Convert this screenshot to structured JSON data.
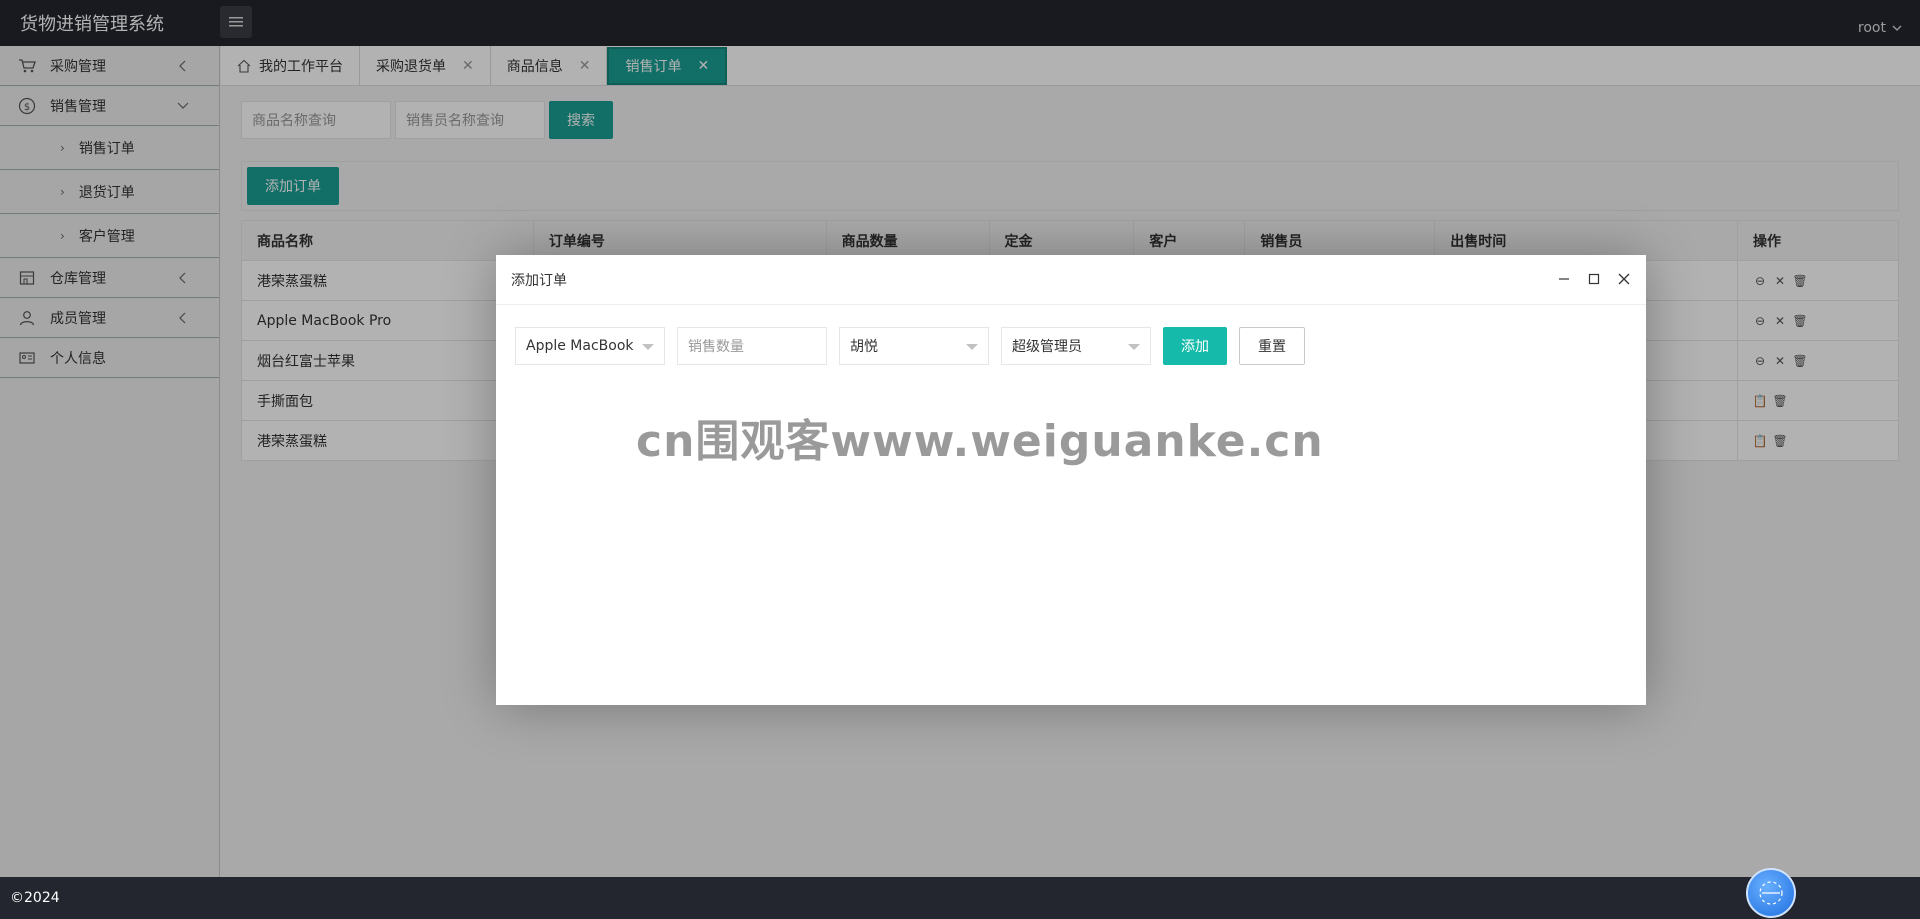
{
  "app": {
    "title": "货物进销管理系统",
    "user": "root"
  },
  "sidebar": {
    "items": [
      {
        "label": "采购管理",
        "icon": "cart-icon",
        "expanded": false
      },
      {
        "label": "销售管理",
        "icon": "dollar-circle-icon",
        "expanded": true,
        "children": [
          {
            "label": "销售订单"
          },
          {
            "label": "退货订单"
          },
          {
            "label": "客户管理"
          }
        ]
      },
      {
        "label": "仓库管理",
        "icon": "warehouse-icon",
        "expanded": false
      },
      {
        "label": "成员管理",
        "icon": "user-icon",
        "expanded": false
      },
      {
        "label": "个人信息",
        "icon": "id-card-icon",
        "expanded": false
      }
    ]
  },
  "tabs": [
    {
      "label": "我的工作平台",
      "icon": "home-icon",
      "closable": false
    },
    {
      "label": "采购退货单",
      "closable": true
    },
    {
      "label": "商品信息",
      "closable": true
    },
    {
      "label": "销售订单",
      "closable": true,
      "active": true
    }
  ],
  "search": {
    "product_placeholder": "商品名称查询",
    "seller_placeholder": "销售员名称查询",
    "button": "搜索"
  },
  "toolbar": {
    "add_button": "添加订单"
  },
  "table": {
    "headers": [
      "商品名称",
      "订单编号",
      "商品数量",
      "定金",
      "客户",
      "销售员",
      "出售时间",
      "操作"
    ],
    "rows": [
      {
        "name": "港荣蒸蛋糕",
        "ops": [
          "cancel-circle-icon",
          "close-icon",
          "trash-icon"
        ]
      },
      {
        "name": "Apple MacBook Pro",
        "ops": [
          "cancel-circle-icon",
          "close-icon",
          "trash-icon"
        ]
      },
      {
        "name": "烟台红富士苹果",
        "ops": [
          "cancel-circle-icon",
          "close-icon",
          "trash-icon"
        ]
      },
      {
        "name": "手撕面包",
        "ops": [
          "clipboard-icon",
          "trash-icon"
        ]
      },
      {
        "name": "港荣蒸蛋糕",
        "ops": [
          "clipboard-icon",
          "trash-icon"
        ]
      }
    ]
  },
  "modal": {
    "title": "添加订单",
    "product_select": "Apple MacBook Pro",
    "quantity_placeholder": "销售数量",
    "customer_select": "胡悦",
    "seller_select": "超级管理员",
    "add_button": "添加",
    "reset_button": "重置",
    "watermark": "cn围观客www.weiguanke.cn"
  },
  "footer": {
    "copyright": "©2024"
  },
  "colors": {
    "header": "#23262e",
    "accent": "#1aa094",
    "accent_button": "#16baaa"
  }
}
